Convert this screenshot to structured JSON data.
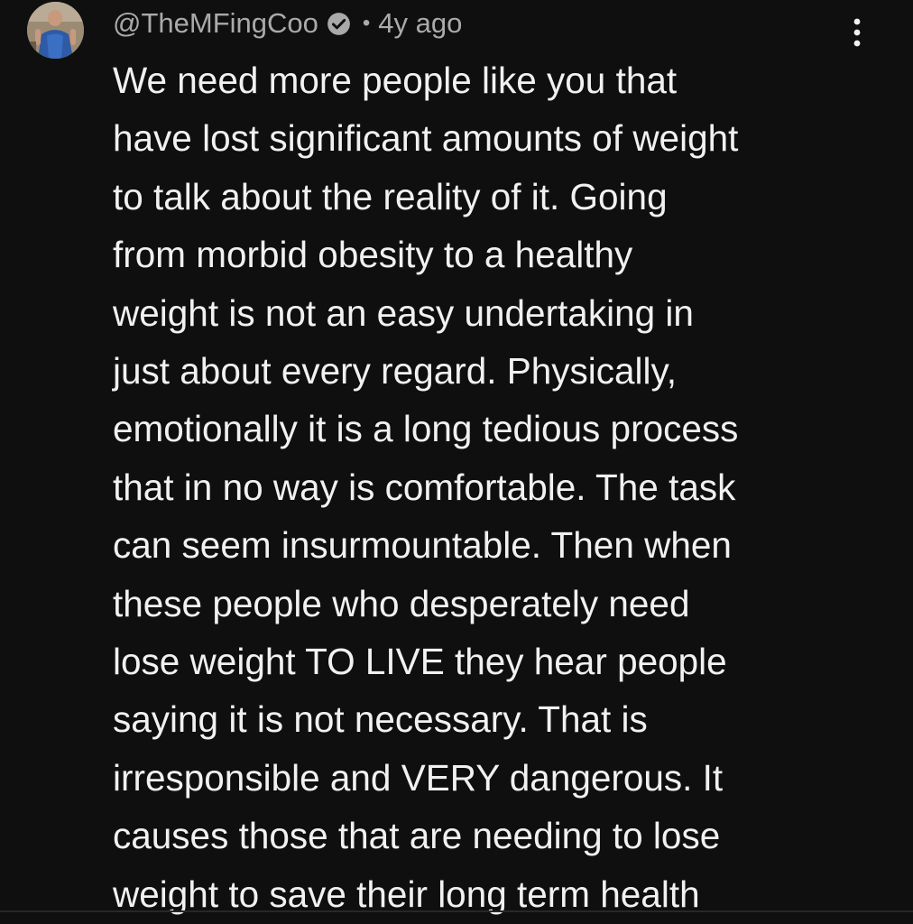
{
  "comment": {
    "author": "@TheMFingCoo",
    "verified": true,
    "verified_icon": "check-circle-icon",
    "separator": "•",
    "time": "4y ago",
    "more_icon": "more-vertical-icon",
    "text_lines": [
      "We need more people like you that",
      "have lost significant amounts of weight",
      "to talk about the reality of it. Going",
      "from morbid obesity to a healthy",
      "weight is not an easy undertaking in",
      "just about every regard. Physically,",
      "emotionally it is a long tedious process",
      "that in no way is comfortable. The task",
      "can seem insurmountable. Then when",
      "these people who desperately need",
      "lose weight TO LIVE they hear people",
      "saying it is not necessary. That is",
      "irresponsible and VERY dangerous. It",
      "causes those that are needing to lose",
      "weight to save their long term health"
    ]
  },
  "colors": {
    "background": "#0f0f0f",
    "text_primary": "#f1f1f1",
    "text_secondary": "#aaaaaa"
  }
}
